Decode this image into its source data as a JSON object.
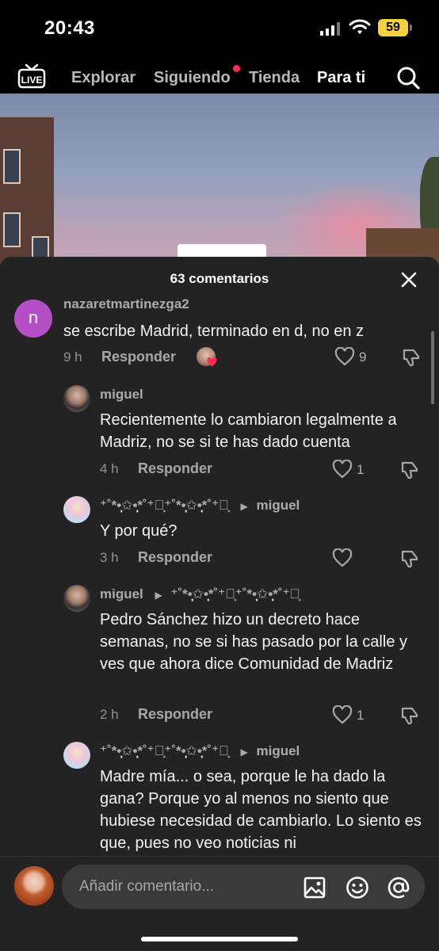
{
  "status_bar": {
    "time": "20:43",
    "battery": "59"
  },
  "nav": {
    "live": "LIVE",
    "tabs": [
      {
        "label": "Explorar"
      },
      {
        "label": "Siguiendo"
      },
      {
        "label": "Tienda"
      },
      {
        "label": "Para ti"
      }
    ],
    "active_tab": "Para ti"
  },
  "sheet": {
    "title": "63 comentarios"
  },
  "comments": [
    {
      "username": "nazaretmartinezga2",
      "avatar_letter": "n",
      "text": "se escribe Madrid, terminado en d, no en z",
      "time": "9 h",
      "reply_label": "Responder",
      "likes": "9"
    },
    {
      "username": "miguel",
      "text": "Recientemente lo cambiaron legalmente a Madriz, no se si te has dado cuenta",
      "time": "4 h",
      "reply_label": "Responder",
      "likes": "1"
    },
    {
      "username": "⁺˚*•̩̩͙✩•̩̩͙*˚⁺‧͙⁺˚*•̩̩͙✩•̩̩͙*˚⁺‧͙",
      "reply_to": "miguel",
      "text": "Y por qué?",
      "time": "3 h",
      "reply_label": "Responder",
      "likes": ""
    },
    {
      "username": "miguel",
      "reply_to": "⁺˚*•̩̩͙✩•̩̩͙*˚⁺‧͙⁺˚*•̩̩͙✩•̩̩͙*˚⁺‧͙",
      "text": "Pedro Sánchez hizo un decreto hace semanas, no se si has pasado por la calle y ves que ahora dice Comunidad de Madriz",
      "time": "2 h",
      "reply_label": "Responder",
      "likes": "1"
    },
    {
      "username": "⁺˚*•̩̩͙✩•̩̩͙*˚⁺‧͙⁺˚*•̩̩͙✩•̩̩͙*˚⁺‧͙",
      "reply_to": "miguel",
      "text": "Madre mía... o sea, porque le ha dado la gana? Porque yo al menos no siento que hubiese necesidad de cambiarlo. Lo siento es que, pues no veo noticias ni",
      "time": "",
      "reply_label": "",
      "likes": ""
    }
  ],
  "input": {
    "placeholder": "Añadir comentario..."
  },
  "colors": {
    "sheet_bg": "#232323",
    "accent_red": "#fe2c55",
    "battery": "#f5d23d"
  }
}
